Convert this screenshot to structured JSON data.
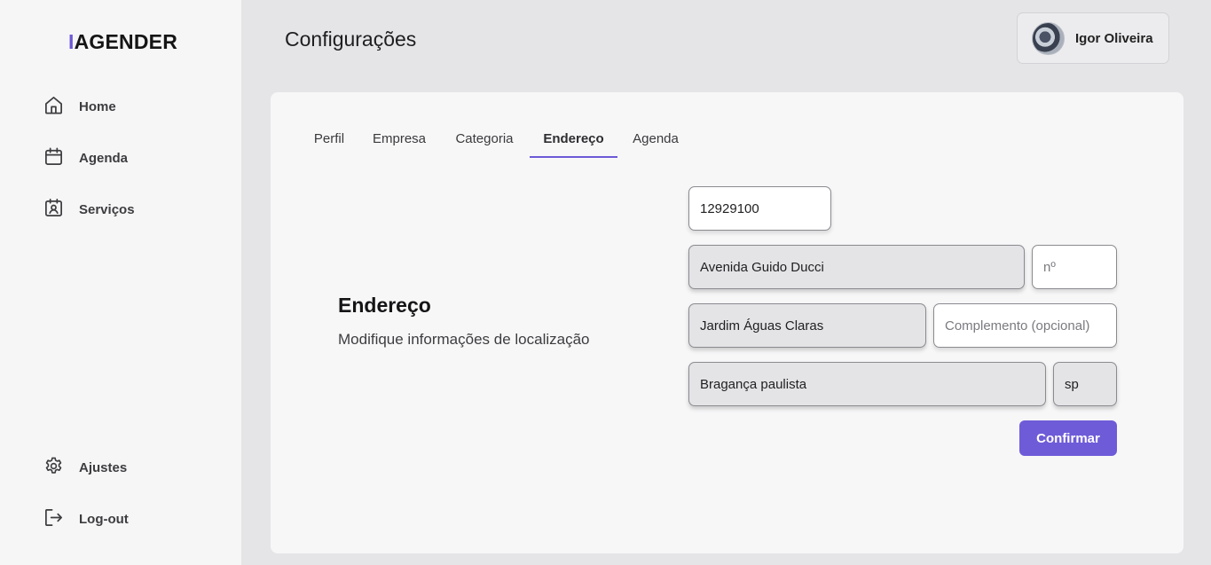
{
  "app": {
    "logo_bar": "I",
    "logo_text": "AGENDER"
  },
  "sidebar": {
    "items": [
      {
        "label": "Home",
        "icon": "home-icon"
      },
      {
        "label": "Agenda",
        "icon": "calendar-icon"
      },
      {
        "label": "Serviços",
        "icon": "contact-card-icon"
      }
    ],
    "bottom": [
      {
        "label": "Ajustes",
        "icon": "gear-icon"
      },
      {
        "label": "Log-out",
        "icon": "logout-icon"
      }
    ]
  },
  "header": {
    "title": "Configurações",
    "user": {
      "name": "Igor Oliveira"
    }
  },
  "tabs": [
    {
      "label": "Perfil",
      "active": false
    },
    {
      "label": "Empresa",
      "active": false
    },
    {
      "label": "Categoria",
      "active": false
    },
    {
      "label": "Endereço",
      "active": true
    },
    {
      "label": "Agenda",
      "active": false
    }
  ],
  "section": {
    "title": "Endereço",
    "description": "Modifique informações de localização"
  },
  "form": {
    "cep": {
      "value": "12929100"
    },
    "street": {
      "value": "Avenida Guido Ducci"
    },
    "number": {
      "value": "",
      "placeholder": "nº"
    },
    "neighborhood": {
      "value": "Jardim Águas Claras"
    },
    "complement": {
      "value": "",
      "placeholder": "Complemento (opcional)"
    },
    "city": {
      "value": "Bragança paulista"
    },
    "state": {
      "value": "sp"
    },
    "confirm_label": "Confirmar"
  },
  "colors": {
    "accent": "#6e5bd8",
    "background": "#e5e4e7",
    "sidebar": "#f6f6f7",
    "card": "#f7f7f8"
  }
}
